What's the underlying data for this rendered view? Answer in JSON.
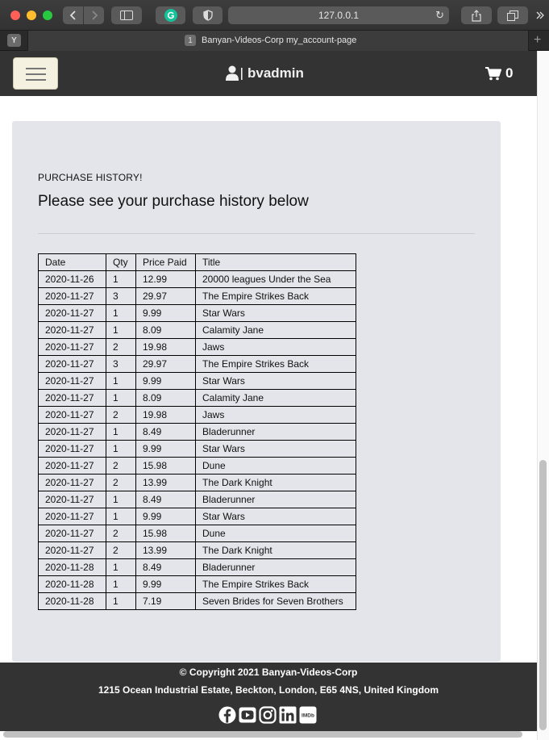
{
  "browser": {
    "url": "127.0.0.1",
    "tab_number": "1",
    "tab_title": "Banyan-Videos-Corp my_account-page",
    "favicon_letter": "Y"
  },
  "navbar": {
    "username": "bvadmin",
    "cart_count": "0"
  },
  "content": {
    "section_label": "PURCHASE HISTORY!",
    "section_heading": "Please see your purchase history below",
    "table": {
      "headers": [
        "Date",
        "Qty",
        "Price Paid",
        "Title"
      ],
      "rows": [
        [
          "2020-11-26",
          "1",
          "12.99",
          "20000 leagues Under the Sea"
        ],
        [
          "2020-11-27",
          "3",
          "29.97",
          "The Empire Strikes Back"
        ],
        [
          "2020-11-27",
          "1",
          "9.99",
          "Star Wars"
        ],
        [
          "2020-11-27",
          "1",
          "8.09",
          "Calamity Jane"
        ],
        [
          "2020-11-27",
          "2",
          "19.98",
          "Jaws"
        ],
        [
          "2020-11-27",
          "3",
          "29.97",
          "The Empire Strikes Back"
        ],
        [
          "2020-11-27",
          "1",
          "9.99",
          "Star Wars"
        ],
        [
          "2020-11-27",
          "1",
          "8.09",
          "Calamity Jane"
        ],
        [
          "2020-11-27",
          "2",
          "19.98",
          "Jaws"
        ],
        [
          "2020-11-27",
          "1",
          "8.49",
          "Bladerunner"
        ],
        [
          "2020-11-27",
          "1",
          "9.99",
          "Star Wars"
        ],
        [
          "2020-11-27",
          "2",
          "15.98",
          "Dune"
        ],
        [
          "2020-11-27",
          "2",
          "13.99",
          "The Dark Knight"
        ],
        [
          "2020-11-27",
          "1",
          "8.49",
          "Bladerunner"
        ],
        [
          "2020-11-27",
          "1",
          "9.99",
          "Star Wars"
        ],
        [
          "2020-11-27",
          "2",
          "15.98",
          "Dune"
        ],
        [
          "2020-11-27",
          "2",
          "13.99",
          "The Dark Knight"
        ],
        [
          "2020-11-28",
          "1",
          "8.49",
          "Bladerunner"
        ],
        [
          "2020-11-28",
          "1",
          "9.99",
          "The Empire Strikes Back"
        ],
        [
          "2020-11-28",
          "1",
          "7.19",
          "Seven Brides for Seven Brothers"
        ]
      ]
    }
  },
  "footer": {
    "copyright": "© Copyright 2021 Banyan-Videos-Corp",
    "address": "1215 Ocean Industrial Estate, Beckton, London, E65 4NS, United Kingdom",
    "social_icons": [
      "facebook-icon",
      "youtube-icon",
      "instagram-icon",
      "linkedin-icon",
      "imdb-icon"
    ],
    "imdb_text": "IMDb"
  }
}
